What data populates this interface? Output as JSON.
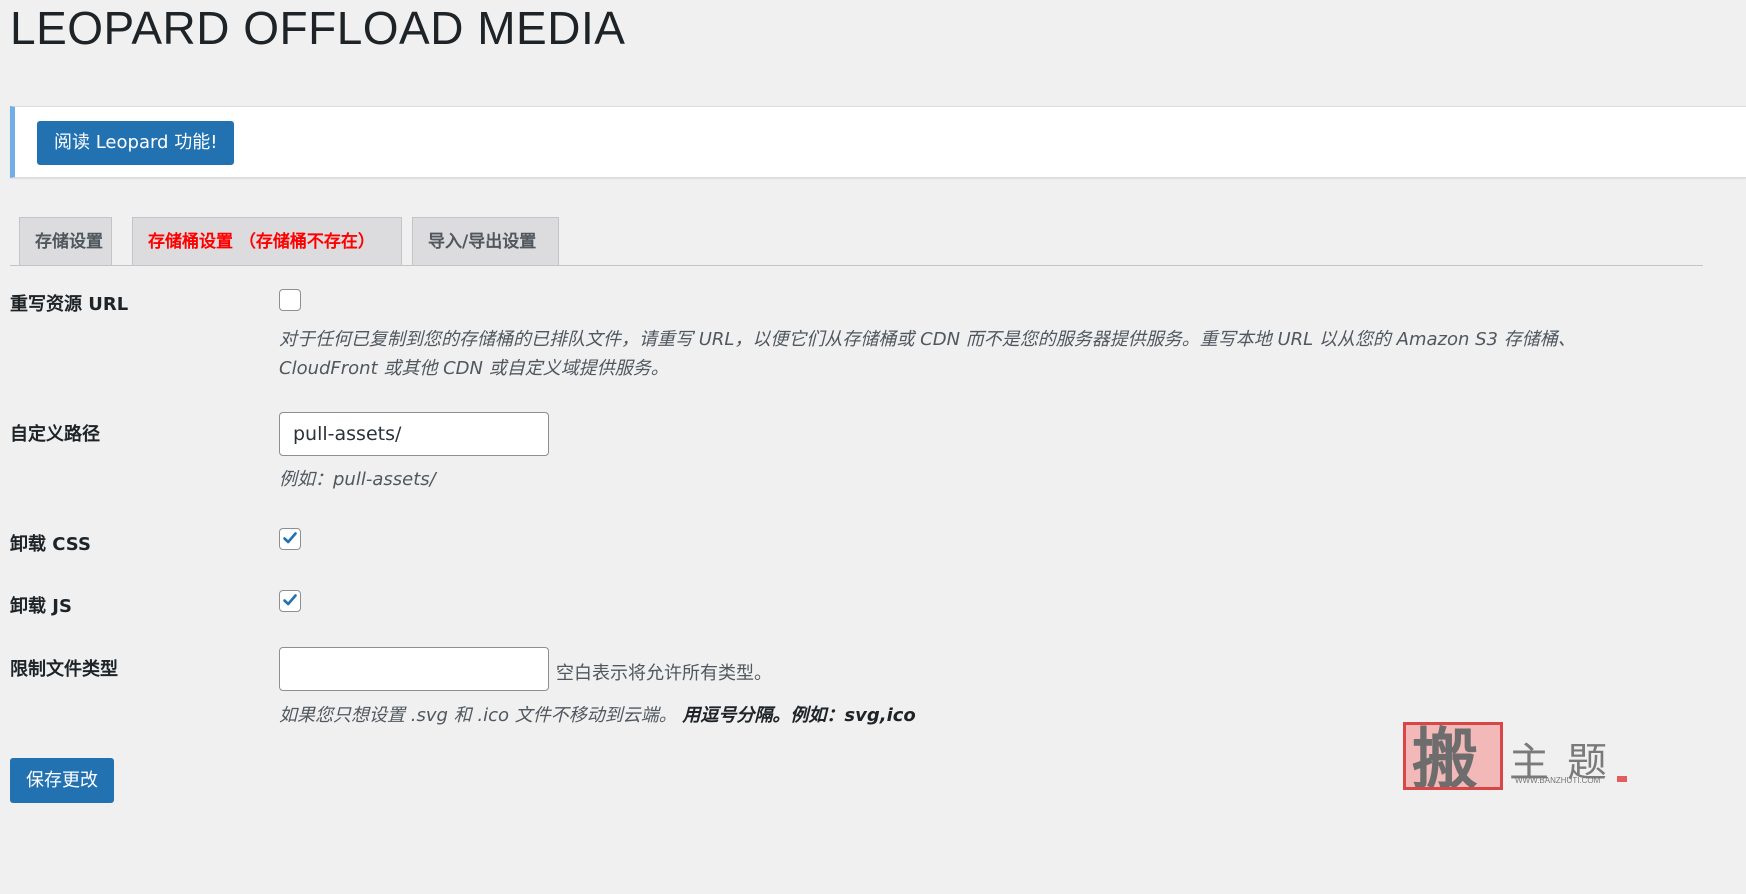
{
  "page": {
    "title": "LEOPARD OFFLOAD MEDIA"
  },
  "notice": {
    "button_label": "阅读 Leopard 功能!"
  },
  "tabs": [
    {
      "label": "存储设置",
      "active": false
    },
    {
      "label": "存储桶设置 （存储桶不存在）",
      "active": true
    },
    {
      "label": "导入/导出设置",
      "active": false
    }
  ],
  "fields": {
    "rewrite_url": {
      "label": "重写资源 URL",
      "checked": false,
      "description_line1": "对于任何已复制到您的存储桶的已排队文件，请重写 URL，以便它们从存储桶或 CDN 而不是您的服务器提供服务。重写本地 URL 以从您的 Amazon S3 存储桶、",
      "description_line2": "CloudFront 或其他 CDN 或自定义域提供服务。"
    },
    "custom_path": {
      "label": "自定义路径",
      "value": "pull-assets/",
      "hint": "例如：pull-assets/"
    },
    "offload_css": {
      "label": "卸载 CSS",
      "checked": true
    },
    "offload_js": {
      "label": "卸载 JS",
      "checked": true
    },
    "limit_types": {
      "label": "限制文件类型",
      "value": "",
      "inline_hint": "空白表示将允许所有类型。",
      "desc_plain": "如果您只想设置 .svg 和 .ico 文件不移动到云端。 ",
      "desc_bold": "用逗号分隔。例如：svg,ico"
    }
  },
  "save_button": "保存更改",
  "watermark": {
    "glyph": "搬",
    "title": "主题",
    "url": "WWW.BANZHUTI.COM"
  },
  "colors": {
    "primary": "#2271b1",
    "error_tab": "#ff0000",
    "notice_border": "#72aee6",
    "background": "#f0f0f1"
  }
}
